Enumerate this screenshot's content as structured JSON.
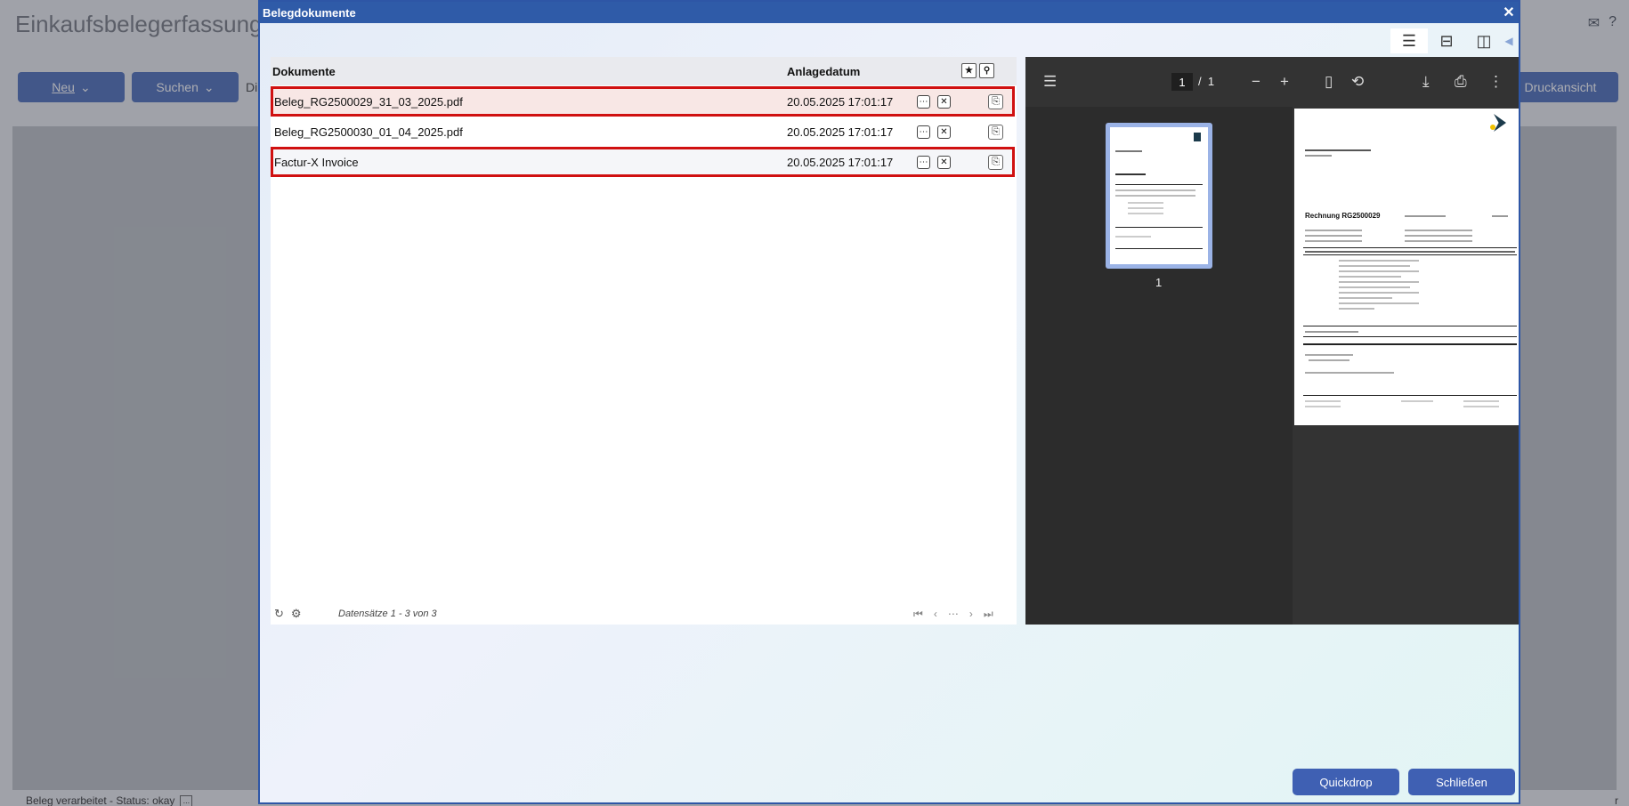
{
  "background": {
    "app_title": "Einkaufsbelegerfassung",
    "btn_new": "Neu",
    "btn_search": "Suchen",
    "fragment_di": "Di",
    "btn_print": "Druckansicht",
    "status_text": "Beleg verarbeitet - Status: okay",
    "status_mini": "...",
    "right_fragment": "r"
  },
  "modal": {
    "title": "Belegdokumente",
    "close_glyph": "✕",
    "list": {
      "col_documents": "Dokumente",
      "col_date": "Anlagedatum",
      "rows": [
        {
          "name": "Beleg_RG2500029_31_03_2025.pdf",
          "date": "20.05.2025 17:01:17"
        },
        {
          "name": "Beleg_RG2500030_01_04_2025.pdf",
          "date": "20.05.2025 17:01:17"
        },
        {
          "name": "Factur-X Invoice",
          "date": "20.05.2025 17:01:17"
        }
      ],
      "records": "Datensätze 1 - 3 von 3"
    },
    "pdf": {
      "current_page": "1",
      "page_sep": "/",
      "total_pages": "1",
      "thumb_label": "1",
      "doc_heading": "Rechnung RG2500029"
    },
    "buttons": {
      "quickdrop": "Quickdrop",
      "close": "Schließen"
    }
  },
  "colors": {
    "accent": "#3f60b3",
    "header": "#2f5ba8",
    "highlight_border": "#d01010"
  }
}
